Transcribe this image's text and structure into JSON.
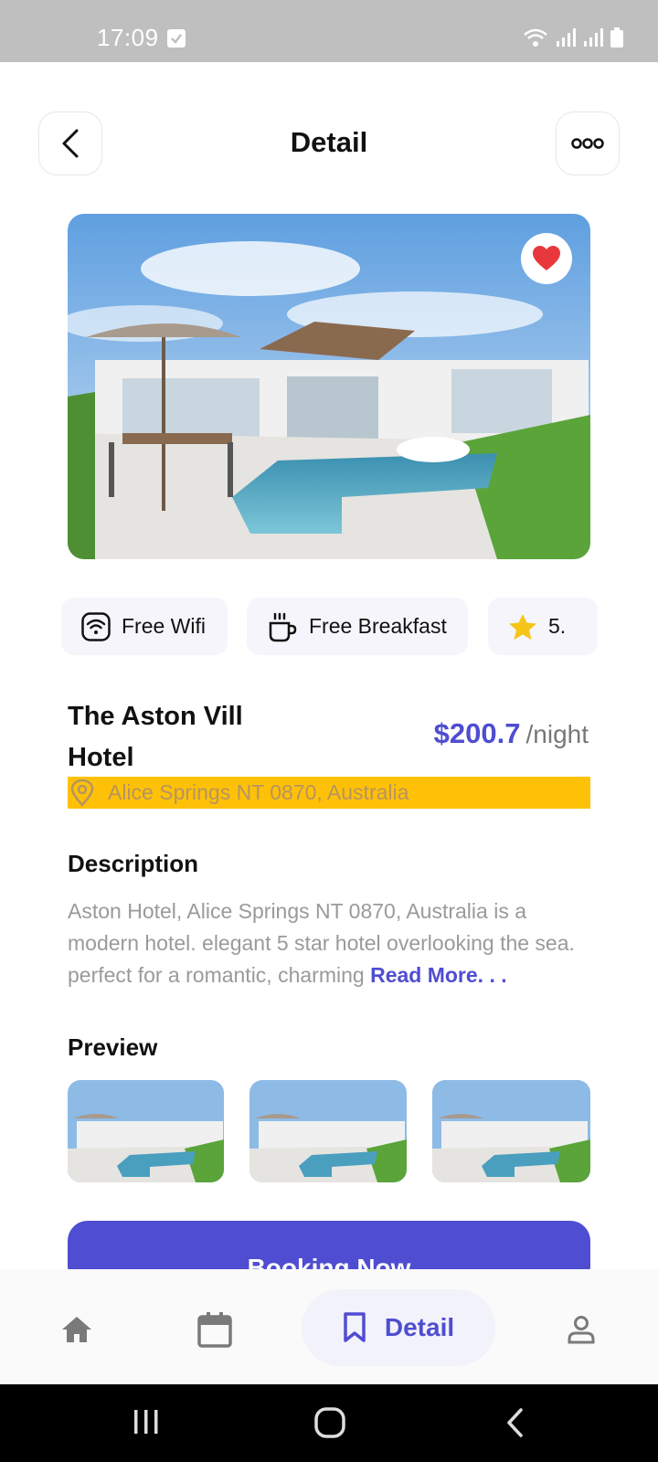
{
  "status_bar": {
    "time": "17:09"
  },
  "header": {
    "title": "Detail"
  },
  "amenities": [
    {
      "label": "Free Wifi",
      "icon": "wifi-icon"
    },
    {
      "label": "Free Breakfast",
      "icon": "coffee-cup-icon"
    },
    {
      "label": "5.",
      "icon": "star-icon"
    }
  ],
  "hotel": {
    "name": "The Aston Vill Hotel",
    "price": "$200.7",
    "price_unit": "/night",
    "location": "Alice Springs NT 0870, Australia"
  },
  "description": {
    "title": "Description",
    "text": "Aston Hotel, Alice Springs NT 0870, Australia is a modern hotel. elegant 5 star hotel overlooking the sea. perfect for a romantic, charming",
    "read_more": "Read More. . ."
  },
  "preview": {
    "title": "Preview"
  },
  "booking_button": "Booking Now",
  "bottom_nav": {
    "active_label": "Detail"
  },
  "colors": {
    "accent": "#4f4dd1",
    "location_bg": "#ffc107",
    "heart": "#e8383d",
    "star": "#f5c518"
  }
}
